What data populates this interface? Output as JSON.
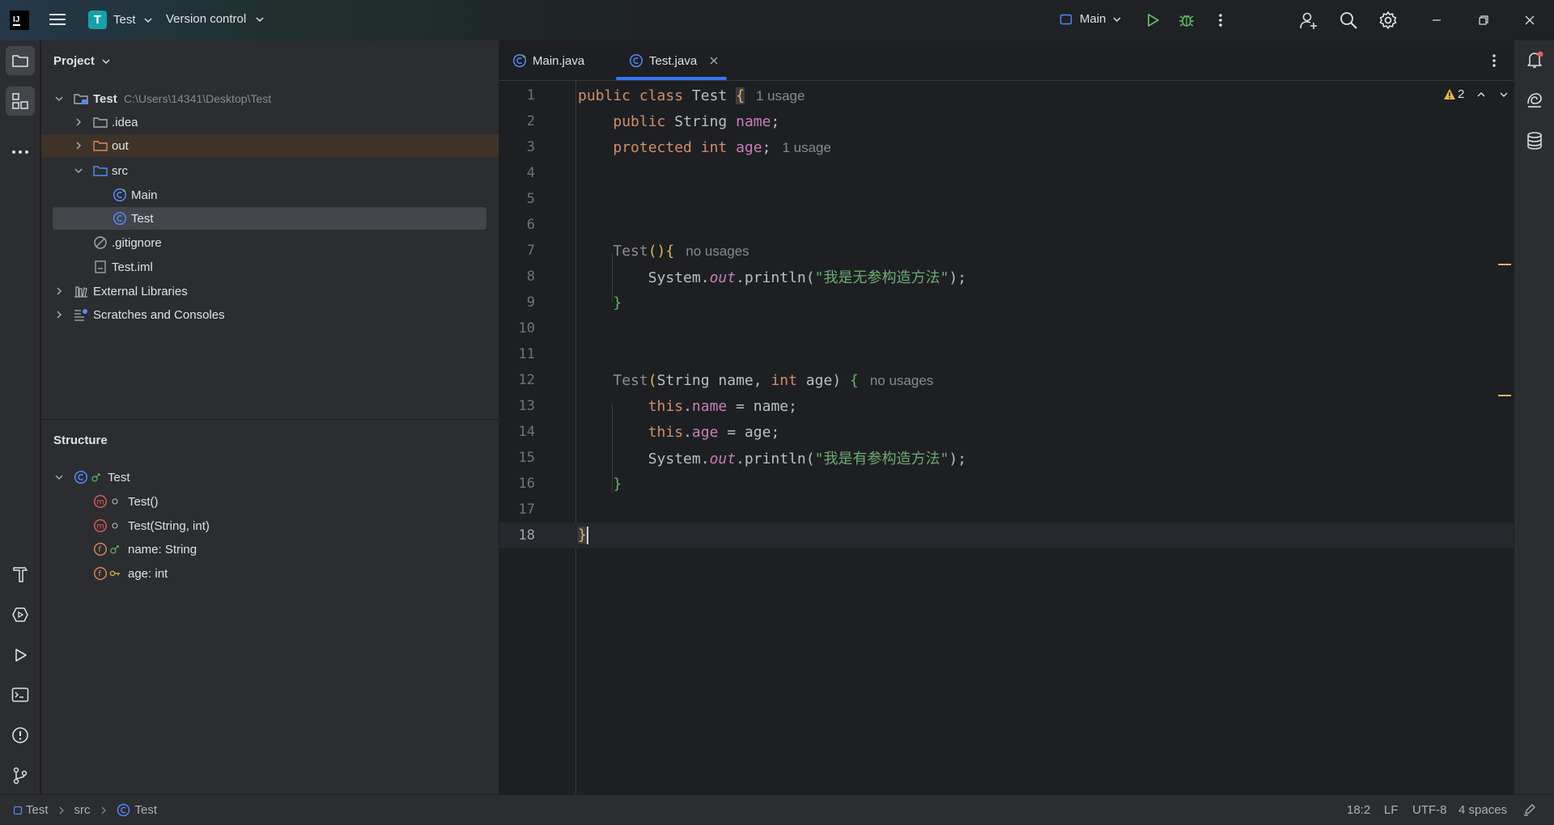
{
  "titlebar": {
    "project_badge": "T",
    "project_name": "Test",
    "vcs_label": "Version control",
    "run_config": "Main"
  },
  "project_panel": {
    "title": "Project",
    "tree": [
      {
        "label": "Test",
        "path": "C:\\Users\\14341\\Desktop\\Test"
      },
      {
        "label": ".idea"
      },
      {
        "label": "out"
      },
      {
        "label": "src"
      },
      {
        "label": "Main"
      },
      {
        "label": "Test"
      },
      {
        "label": ".gitignore"
      },
      {
        "label": "Test.iml"
      },
      {
        "label": "External Libraries"
      },
      {
        "label": "Scratches and Consoles"
      }
    ]
  },
  "structure_panel": {
    "title": "Structure",
    "items": [
      {
        "label": "Test"
      },
      {
        "label": "Test()"
      },
      {
        "label": "Test(String, int)"
      },
      {
        "label": "name: String"
      },
      {
        "label": "age: int"
      }
    ]
  },
  "editor": {
    "tabs": [
      {
        "label": "Main.java",
        "active": false
      },
      {
        "label": "Test.java",
        "active": true
      }
    ],
    "warnings_count": "2",
    "line_numbers": [
      "1",
      "2",
      "3",
      "4",
      "5",
      "6",
      "7",
      "8",
      "9",
      "10",
      "11",
      "12",
      "13",
      "14",
      "15",
      "16",
      "17",
      "18"
    ],
    "hints": {
      "l1": "1 usage",
      "l3": "1 usage",
      "l7": "no usages",
      "l12": "no usages"
    },
    "code": {
      "l1_kw": "public class",
      "l1_name": "Test",
      "l1_brace": "{",
      "l2_kw": "public",
      "l2_type": "String",
      "l2_field": "name",
      "l3_kw": "protected int",
      "l3_field": "age",
      "l7_ctor": "Test",
      "l7_punct": "(){",
      "l8_a": "System.",
      "l8_out": "out",
      "l8_b": ".println(",
      "l8_str": "\"我是无参构造方法\"",
      "l8_c": ");",
      "l9": "}",
      "l12_ctor": "Test",
      "l12_open": "(",
      "l12_t1": "String name, ",
      "l12_int": "int",
      "l12_rest": " age) ",
      "l12_brace": "{",
      "l13_this": "this",
      "l13_dot": ".",
      "l13_field": "name",
      "l13_rest": " = name;",
      "l14_this": "this",
      "l14_dot": ".",
      "l14_field": "age",
      "l14_rest": " = age;",
      "l15_a": "System.",
      "l15_out": "out",
      "l15_b": ".println(",
      "l15_str": "\"我是有参构造方法\"",
      "l15_c": ");",
      "l16": "}",
      "l18": "}"
    }
  },
  "statusbar": {
    "breadcrumb": [
      "Test",
      "src",
      "Test"
    ],
    "position": "18:2",
    "line_sep": "LF",
    "encoding": "UTF-8",
    "indent": "4 spaces"
  },
  "colors": {
    "keyword": "#cf8e6d",
    "field": "#c77dbb",
    "string": "#6aab73",
    "accent": "#3574f0",
    "run_green": "#5fb865"
  }
}
